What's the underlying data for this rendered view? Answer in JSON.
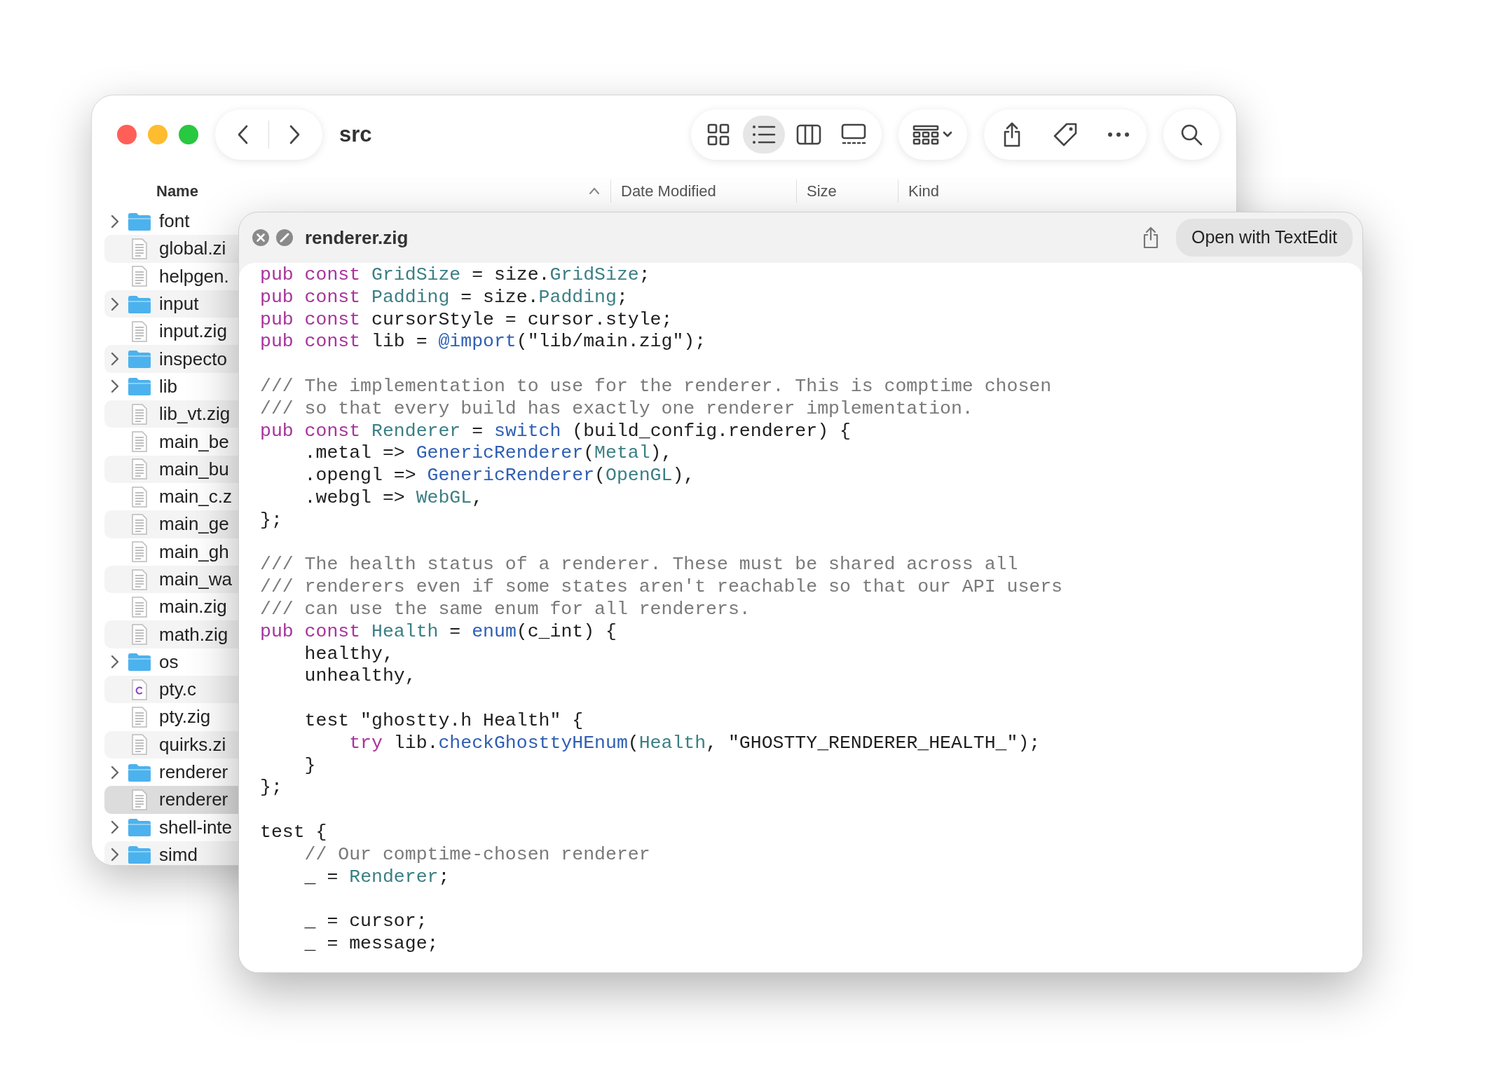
{
  "finder": {
    "title": "src",
    "toolbar": {
      "views": [
        {
          "kind": "icons",
          "selected": false
        },
        {
          "kind": "list",
          "selected": true
        },
        {
          "kind": "columns",
          "selected": false
        },
        {
          "kind": "gallery",
          "selected": false
        }
      ]
    },
    "columns": [
      {
        "label": "Name",
        "sorted": true
      },
      {
        "label": "Date Modified",
        "sorted": false
      },
      {
        "label": "Size",
        "sorted": false
      },
      {
        "label": "Kind",
        "sorted": false
      }
    ],
    "items": [
      {
        "name": "font",
        "kind": "folder",
        "selected": false
      },
      {
        "name": "global.zi",
        "kind": "file",
        "selected": false
      },
      {
        "name": "helpgen.",
        "kind": "file",
        "selected": false
      },
      {
        "name": "input",
        "kind": "folder",
        "selected": false
      },
      {
        "name": "input.zig",
        "kind": "file",
        "selected": false
      },
      {
        "name": "inspecto",
        "kind": "folder",
        "selected": false
      },
      {
        "name": "lib",
        "kind": "folder",
        "selected": false
      },
      {
        "name": "lib_vt.zig",
        "kind": "file",
        "selected": false
      },
      {
        "name": "main_be",
        "kind": "file",
        "selected": false
      },
      {
        "name": "main_bu",
        "kind": "file",
        "selected": false
      },
      {
        "name": "main_c.z",
        "kind": "file",
        "selected": false
      },
      {
        "name": "main_ge",
        "kind": "file",
        "selected": false
      },
      {
        "name": "main_gh",
        "kind": "file",
        "selected": false
      },
      {
        "name": "main_wa",
        "kind": "file",
        "selected": false
      },
      {
        "name": "main.zig",
        "kind": "file",
        "selected": false
      },
      {
        "name": "math.zig",
        "kind": "file",
        "selected": false
      },
      {
        "name": "os",
        "kind": "folder",
        "selected": false
      },
      {
        "name": "pty.c",
        "kind": "c",
        "selected": false
      },
      {
        "name": "pty.zig",
        "kind": "file",
        "selected": false
      },
      {
        "name": "quirks.zi",
        "kind": "file",
        "selected": false
      },
      {
        "name": "renderer",
        "kind": "folder",
        "selected": false
      },
      {
        "name": "renderer",
        "kind": "file",
        "selected": true
      },
      {
        "name": "shell-inte",
        "kind": "folder",
        "selected": false
      },
      {
        "name": "simd",
        "kind": "folder",
        "selected": false
      }
    ]
  },
  "quick_look": {
    "title": "renderer.zig",
    "open_button": "Open with TextEdit",
    "lines": [
      {
        "kind": "code",
        "tokens": [
          {
            "kind": "keyword",
            "text": "pub const "
          },
          {
            "kind": "type",
            "text": "GridSize"
          },
          {
            "kind": "plain",
            "text": " = size."
          },
          {
            "kind": "type",
            "text": "GridSize"
          },
          {
            "kind": "plain",
            "text": ";"
          }
        ]
      },
      {
        "kind": "code",
        "tokens": [
          {
            "kind": "keyword",
            "text": "pub const "
          },
          {
            "kind": "type",
            "text": "Padding"
          },
          {
            "kind": "plain",
            "text": " = size."
          },
          {
            "kind": "type",
            "text": "Padding"
          },
          {
            "kind": "plain",
            "text": ";"
          }
        ]
      },
      {
        "kind": "code",
        "tokens": [
          {
            "kind": "keyword",
            "text": "pub const "
          },
          {
            "kind": "plain",
            "text": "cursorStyle = cursor.style;"
          }
        ]
      },
      {
        "kind": "code",
        "tokens": [
          {
            "kind": "keyword",
            "text": "pub const "
          },
          {
            "kind": "plain",
            "text": "lib = "
          },
          {
            "kind": "function",
            "text": "@import"
          },
          {
            "kind": "plain",
            "text": "(\"lib/main.zig\");"
          }
        ]
      },
      {
        "kind": "blank"
      },
      {
        "kind": "code",
        "tokens": [
          {
            "kind": "comment",
            "text": "/// The implementation to use for the renderer. This is comptime chosen"
          }
        ]
      },
      {
        "kind": "code",
        "tokens": [
          {
            "kind": "comment",
            "text": "/// so that every build has exactly one renderer implementation."
          }
        ]
      },
      {
        "kind": "code",
        "tokens": [
          {
            "kind": "keyword",
            "text": "pub const "
          },
          {
            "kind": "type",
            "text": "Renderer"
          },
          {
            "kind": "plain",
            "text": " = "
          },
          {
            "kind": "function",
            "text": "switch"
          },
          {
            "kind": "plain",
            "text": " (build_config.renderer) {"
          }
        ]
      },
      {
        "kind": "code",
        "tokens": [
          {
            "kind": "plain",
            "text": "    .metal => "
          },
          {
            "kind": "function",
            "text": "GenericRenderer"
          },
          {
            "kind": "plain",
            "text": "("
          },
          {
            "kind": "type",
            "text": "Metal"
          },
          {
            "kind": "plain",
            "text": "),"
          }
        ]
      },
      {
        "kind": "code",
        "tokens": [
          {
            "kind": "plain",
            "text": "    .opengl => "
          },
          {
            "kind": "function",
            "text": "GenericRenderer"
          },
          {
            "kind": "plain",
            "text": "("
          },
          {
            "kind": "type",
            "text": "OpenGL"
          },
          {
            "kind": "plain",
            "text": "),"
          }
        ]
      },
      {
        "kind": "code",
        "tokens": [
          {
            "kind": "plain",
            "text": "    .webgl => "
          },
          {
            "kind": "type",
            "text": "WebGL"
          },
          {
            "kind": "plain",
            "text": ","
          }
        ]
      },
      {
        "kind": "code",
        "tokens": [
          {
            "kind": "plain",
            "text": "};"
          }
        ]
      },
      {
        "kind": "blank"
      },
      {
        "kind": "code",
        "tokens": [
          {
            "kind": "comment",
            "text": "/// The health status of a renderer. These must be shared across all"
          }
        ]
      },
      {
        "kind": "code",
        "tokens": [
          {
            "kind": "comment",
            "text": "/// renderers even if some states aren't reachable so that our API users"
          }
        ]
      },
      {
        "kind": "code",
        "tokens": [
          {
            "kind": "comment",
            "text": "/// can use the same enum for all renderers."
          }
        ]
      },
      {
        "kind": "code",
        "tokens": [
          {
            "kind": "keyword",
            "text": "pub const "
          },
          {
            "kind": "type",
            "text": "Health"
          },
          {
            "kind": "plain",
            "text": " = "
          },
          {
            "kind": "function",
            "text": "enum"
          },
          {
            "kind": "plain",
            "text": "(c_int) {"
          }
        ]
      },
      {
        "kind": "code",
        "tokens": [
          {
            "kind": "plain",
            "text": "    healthy,"
          }
        ]
      },
      {
        "kind": "code",
        "tokens": [
          {
            "kind": "plain",
            "text": "    unhealthy,"
          }
        ]
      },
      {
        "kind": "blank"
      },
      {
        "kind": "code",
        "tokens": [
          {
            "kind": "plain",
            "text": "    test \"ghostty.h Health\" {"
          }
        ]
      },
      {
        "kind": "code",
        "tokens": [
          {
            "kind": "keyword",
            "text": "        try"
          },
          {
            "kind": "plain",
            "text": " lib."
          },
          {
            "kind": "function",
            "text": "checkGhosttyHEnum"
          },
          {
            "kind": "plain",
            "text": "("
          },
          {
            "kind": "type",
            "text": "Health"
          },
          {
            "kind": "plain",
            "text": ", \"GHOSTTY_RENDERER_HEALTH_\");"
          }
        ]
      },
      {
        "kind": "code",
        "tokens": [
          {
            "kind": "plain",
            "text": "    }"
          }
        ]
      },
      {
        "kind": "code",
        "tokens": [
          {
            "kind": "plain",
            "text": "};"
          }
        ]
      },
      {
        "kind": "blank"
      },
      {
        "kind": "code",
        "tokens": [
          {
            "kind": "plain",
            "text": "test {"
          }
        ]
      },
      {
        "kind": "code",
        "tokens": [
          {
            "kind": "comment",
            "text": "    // Our comptime-chosen renderer"
          }
        ]
      },
      {
        "kind": "code",
        "tokens": [
          {
            "kind": "plain",
            "text": "    _ = "
          },
          {
            "kind": "type",
            "text": "Renderer"
          },
          {
            "kind": "plain",
            "text": ";"
          }
        ]
      },
      {
        "kind": "blank"
      },
      {
        "kind": "code",
        "tokens": [
          {
            "kind": "plain",
            "text": "    _ = cursor;"
          }
        ]
      },
      {
        "kind": "code",
        "tokens": [
          {
            "kind": "plain",
            "text": "    _ = message;"
          }
        ]
      }
    ]
  }
}
